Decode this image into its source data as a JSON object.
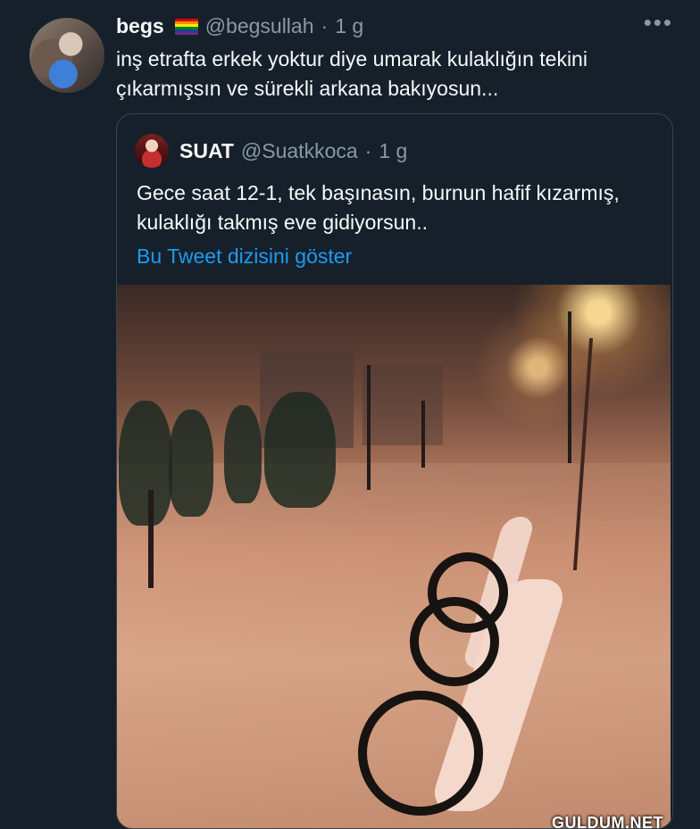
{
  "tweet": {
    "display_name": "begs",
    "handle": "@begsullah",
    "separator": "·",
    "time": "1 g",
    "more": "•••",
    "text": "inş etrafta erkek yoktur diye umarak kulaklığın tekini çıkarmışsın ve sürekli arkana bakıyosun...",
    "flag_icon": "rainbow-flag-icon"
  },
  "quoted": {
    "display_name": "SUAT",
    "handle": "@Suatkkoca",
    "separator": "·",
    "time": "1 g",
    "text": "Gece saat 12-1, tek başınasın, burnun hafif kızarmış, kulaklığı takmış eve gidiyorsun..",
    "show_thread": "Bu Tweet dizisini göster"
  },
  "watermark": "GULDUM.NET",
  "colors": {
    "background": "#15202b",
    "text": "#f7f9f9",
    "muted": "#8b98a5",
    "link": "#1d9bf0",
    "border": "#38444d"
  }
}
